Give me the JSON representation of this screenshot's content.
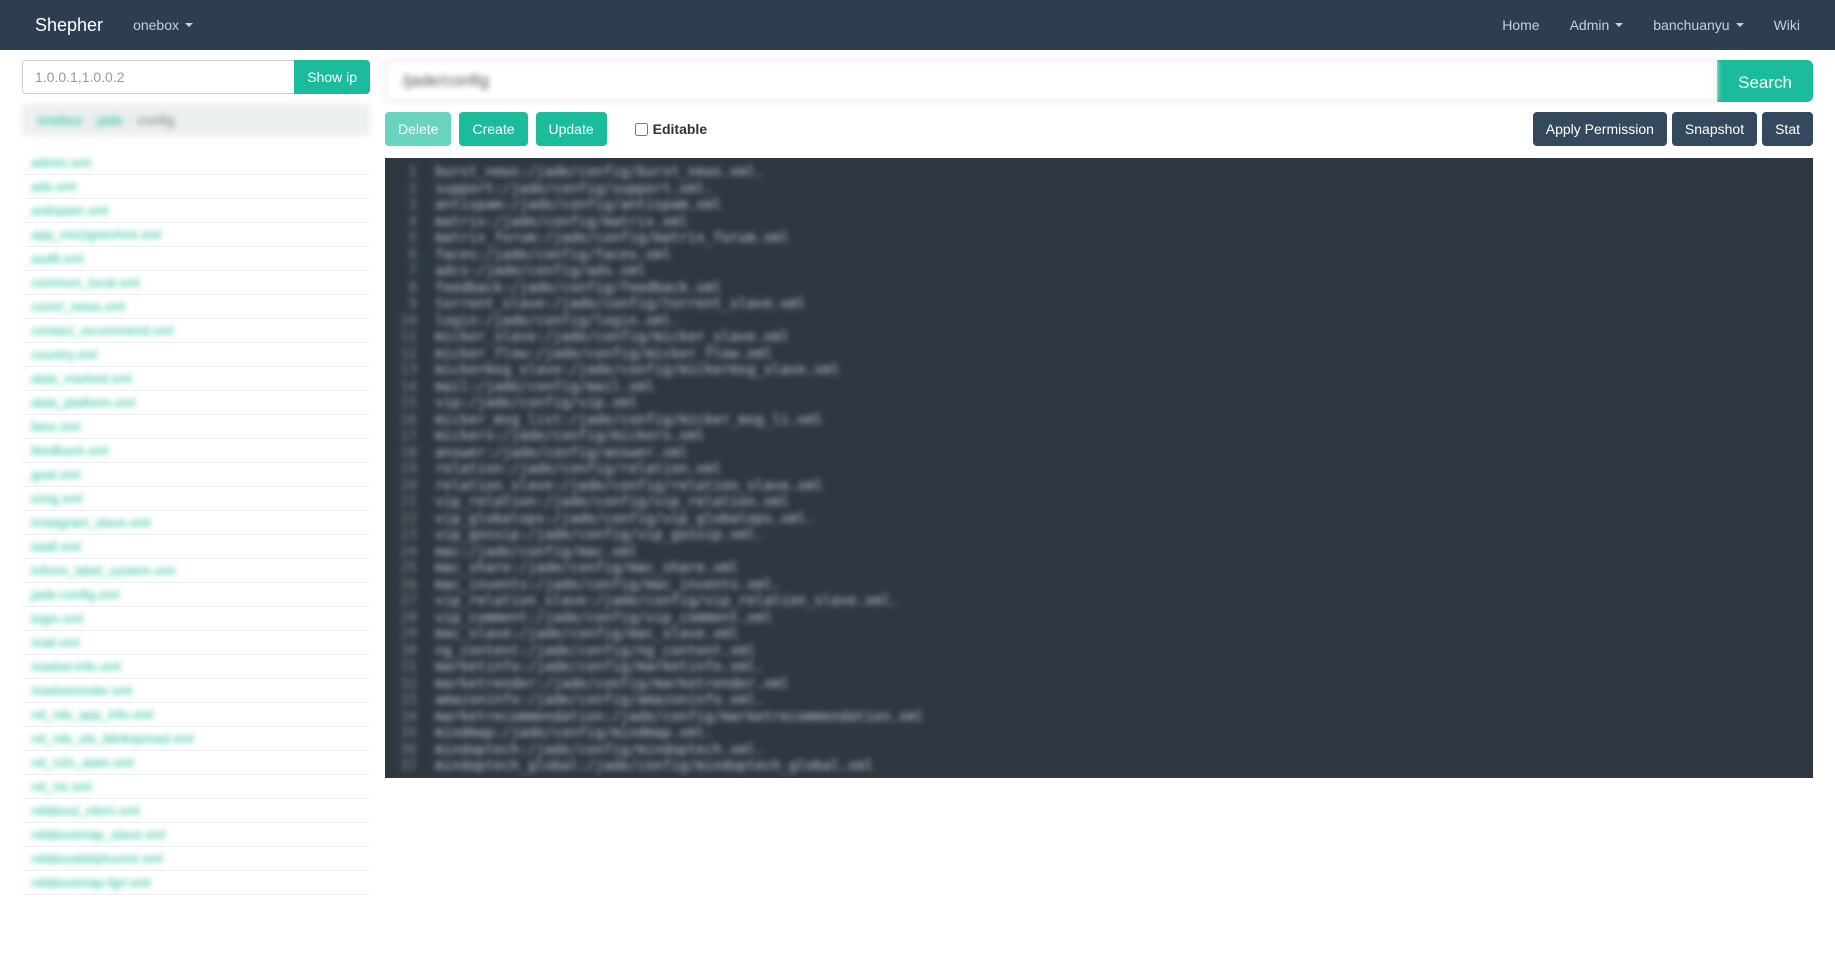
{
  "navbar": {
    "brand": "Shepher",
    "cluster_dropdown": "onebox",
    "home": "Home",
    "admin": "Admin",
    "user": "banchuanyu",
    "wiki": "Wiki"
  },
  "left": {
    "ip_placeholder": "1.0.0.1,1.0.0.2",
    "show_ip": "Show ip",
    "breadcrumb": [
      "onebox",
      "jade",
      "config"
    ],
    "nodes": [
      ".admin.xml",
      ".adx.xml",
      ".antispam.xml",
      ".app_mis2grievhmi.xml",
      ".audit.xml",
      ".common_local.xml",
      ".comrl_news.xml",
      ".contact_recommend.xml",
      ".country.xml",
      ".data_marked.xml",
      ".data_platform.xml",
      ".fans.xml",
      ".feedback.xml",
      ".goal.xml",
      ".icing.xml",
      ".instagram_slave.xml",
      ".iwall.xml",
      ".inform_label_system.xml",
      ".jade-config.xml",
      ".login.xml",
      ".mail.xml",
      ".market-info.xml",
      ".marketrender.xml",
      ".rel_rde_app_info.xml",
      ".rel_rde_sle_blinkspread.xml",
      ".rel_n2n_alain.xml",
      ".rel_ne.xml",
      ".relabout_rdsrn.xml",
      ".relaboutmap_slave.xml",
      ".relaboutdelphunnir.xml",
      ".relaboutmap-fgrl.xml"
    ]
  },
  "right": {
    "search_value": "/jade/config",
    "search_btn": "Search",
    "delete": "Delete",
    "create": "Create",
    "update": "Update",
    "editable": "Editable",
    "apply_permission": "Apply Permission",
    "snapshot": "Snapshot",
    "stat": "Stat",
    "lines": [
      "burst_news:/jade/config/burst_news.xml.",
      "support:/jade/config/support.xml.",
      "antispam:/jade/config/antispam.xml",
      "matrix:/jade/config/matrix.xml",
      "matrix_forum:/jade/config/matrix_forum.xml",
      "faces:/jade/config/faces.xml",
      "adcs:/jade/config/ads.xml",
      "feedback:/jade/config/feedback.xml",
      "torrent_slave:/jade/config/torrent_slave.xml",
      "login:/jade/config/login.xml.",
      "micker_slave:/jade/config/micker_slave.xml",
      "micker_flow:/jade/config/micker_flow.xml",
      "mickermsg_slave:/jade/config/mickermsg_slave.xml",
      "mail:/jade/config/mail.xml",
      "vip:/jade/config/vip.xml",
      "micker_msg_list:/jade/config/micker_msg_li.xml",
      "mickers:/jade/config/mickers.xml",
      "answer:/jade/config/answer.xml",
      "relation:/jade/config/relation.xml",
      "relation_slave:/jade/config/relation_slave.xml",
      "vip_relation:/jade/config/vip_relation.xml",
      "vip_globalops:/jade/config/vip_globalops.xml.",
      "vip_gossip:/jade/config/vip_gossip.xml.",
      "mac:/jade/config/mac.xml",
      "mac_share:/jade/config/mac_share.xml",
      "mac_invents:/jade/config/mac_invents.xml.",
      "vip_relation_slave:/jade/config/vip_relation_slave.xml.",
      "vip_comment:/jade/config/vip_comment.xml",
      "mac_slave:/jade/config/mac_slave.xml",
      "ng_content:/jade/config/ng_content.xml",
      "marketinfo:/jade/config/marketinfo.xml.",
      "marketrender:/jade/config/marketrender.xml",
      "amazoninfo:/jade/config/amazoninfo.xml.",
      "marketrecommendation:/jade/config/marketrecommendation.xml",
      "mindmap:/jade/config/mindmap.xml.",
      "mindoptech:/jade/config/mindoptech.xml.",
      "mindoptech_global:/jade/config/mindoptech_global.xml"
    ]
  }
}
